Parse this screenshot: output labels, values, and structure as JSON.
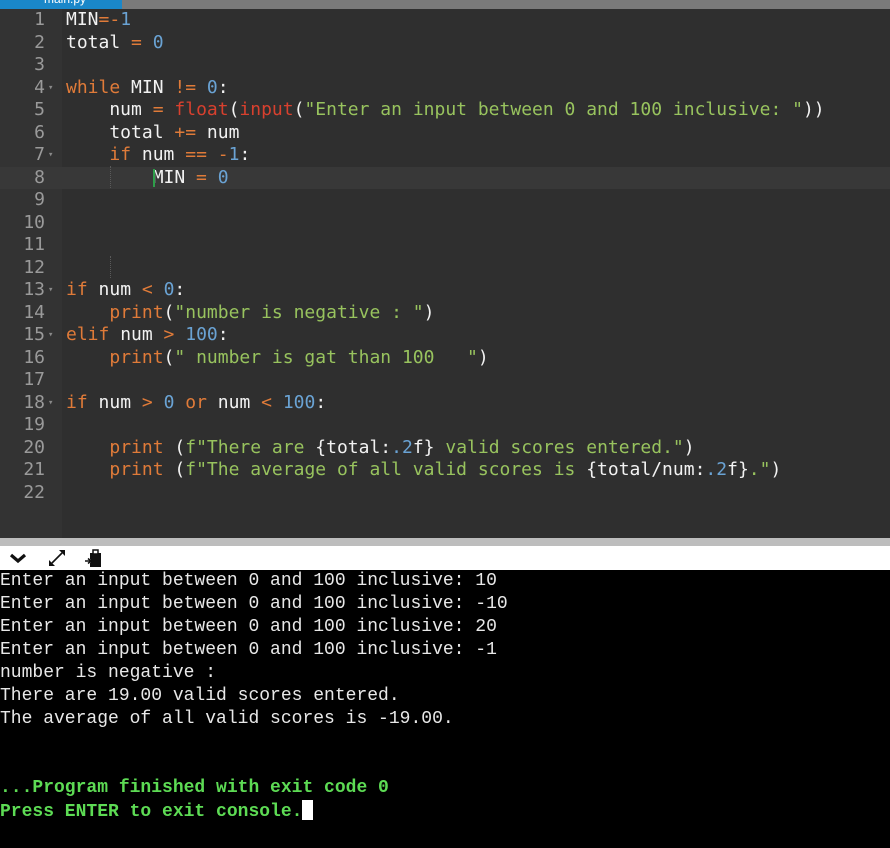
{
  "tab": {
    "label": "main.py"
  },
  "editor": {
    "active_line": 8,
    "lines": [
      {
        "num": "1",
        "fold": false,
        "tokens": [
          {
            "c": "t",
            "v": "MIN"
          },
          {
            "c": "o",
            "v": "=-"
          },
          {
            "c": "n",
            "v": "1"
          }
        ]
      },
      {
        "num": "2",
        "fold": false,
        "tokens": [
          {
            "c": "t",
            "v": "total "
          },
          {
            "c": "o",
            "v": "="
          },
          {
            "c": "t",
            "v": " "
          },
          {
            "c": "n",
            "v": "0"
          }
        ]
      },
      {
        "num": "3",
        "fold": false,
        "tokens": []
      },
      {
        "num": "4",
        "fold": true,
        "tokens": [
          {
            "c": "k",
            "v": "while"
          },
          {
            "c": "t",
            "v": " MIN "
          },
          {
            "c": "o",
            "v": "!="
          },
          {
            "c": "t",
            "v": " "
          },
          {
            "c": "n",
            "v": "0"
          },
          {
            "c": "t",
            "v": ":"
          }
        ]
      },
      {
        "num": "5",
        "fold": false,
        "tokens": [
          {
            "c": "t",
            "v": "    num "
          },
          {
            "c": "o",
            "v": "="
          },
          {
            "c": "t",
            "v": " "
          },
          {
            "c": "f",
            "v": "float"
          },
          {
            "c": "t",
            "v": "("
          },
          {
            "c": "f",
            "v": "input"
          },
          {
            "c": "t",
            "v": "("
          },
          {
            "c": "s",
            "v": "\"Enter an input between 0 and 100 inclusive: \""
          },
          {
            "c": "t",
            "v": "))"
          }
        ]
      },
      {
        "num": "6",
        "fold": false,
        "tokens": [
          {
            "c": "t",
            "v": "    total "
          },
          {
            "c": "o",
            "v": "+="
          },
          {
            "c": "t",
            "v": " num"
          }
        ]
      },
      {
        "num": "7",
        "fold": true,
        "tokens": [
          {
            "c": "t",
            "v": "    "
          },
          {
            "c": "k",
            "v": "if"
          },
          {
            "c": "t",
            "v": " num "
          },
          {
            "c": "o",
            "v": "=="
          },
          {
            "c": "t",
            "v": " "
          },
          {
            "c": "o",
            "v": "-"
          },
          {
            "c": "n",
            "v": "1"
          },
          {
            "c": "t",
            "v": ":"
          }
        ]
      },
      {
        "num": "8",
        "fold": false,
        "tokens": [
          {
            "c": "t",
            "v": "        MIN "
          },
          {
            "c": "o",
            "v": "="
          },
          {
            "c": "t",
            "v": " "
          },
          {
            "c": "n",
            "v": "0"
          }
        ]
      },
      {
        "num": "9",
        "fold": false,
        "tokens": []
      },
      {
        "num": "10",
        "fold": false,
        "tokens": []
      },
      {
        "num": "11",
        "fold": false,
        "tokens": []
      },
      {
        "num": "12",
        "fold": false,
        "tokens": []
      },
      {
        "num": "13",
        "fold": true,
        "tokens": [
          {
            "c": "k",
            "v": "if"
          },
          {
            "c": "t",
            "v": " num "
          },
          {
            "c": "o",
            "v": "<"
          },
          {
            "c": "t",
            "v": " "
          },
          {
            "c": "n",
            "v": "0"
          },
          {
            "c": "t",
            "v": ":"
          }
        ]
      },
      {
        "num": "14",
        "fold": false,
        "tokens": [
          {
            "c": "t",
            "v": "    "
          },
          {
            "c": "k",
            "v": "print"
          },
          {
            "c": "t",
            "v": "("
          },
          {
            "c": "s",
            "v": "\"number is negative : \""
          },
          {
            "c": "t",
            "v": ")"
          }
        ]
      },
      {
        "num": "15",
        "fold": true,
        "tokens": [
          {
            "c": "k",
            "v": "elif"
          },
          {
            "c": "t",
            "v": " num "
          },
          {
            "c": "o",
            "v": ">"
          },
          {
            "c": "t",
            "v": " "
          },
          {
            "c": "n",
            "v": "100"
          },
          {
            "c": "t",
            "v": ":"
          }
        ]
      },
      {
        "num": "16",
        "fold": false,
        "tokens": [
          {
            "c": "t",
            "v": "    "
          },
          {
            "c": "k",
            "v": "print"
          },
          {
            "c": "t",
            "v": "("
          },
          {
            "c": "s",
            "v": "\" number is gat than 100   \""
          },
          {
            "c": "t",
            "v": ")"
          }
        ]
      },
      {
        "num": "17",
        "fold": false,
        "tokens": []
      },
      {
        "num": "18",
        "fold": true,
        "tokens": [
          {
            "c": "k",
            "v": "if"
          },
          {
            "c": "t",
            "v": " num "
          },
          {
            "c": "o",
            "v": ">"
          },
          {
            "c": "t",
            "v": " "
          },
          {
            "c": "n",
            "v": "0"
          },
          {
            "c": "t",
            "v": " "
          },
          {
            "c": "k",
            "v": "or"
          },
          {
            "c": "t",
            "v": " num "
          },
          {
            "c": "o",
            "v": "<"
          },
          {
            "c": "t",
            "v": " "
          },
          {
            "c": "n",
            "v": "100"
          },
          {
            "c": "t",
            "v": ":"
          }
        ]
      },
      {
        "num": "19",
        "fold": false,
        "tokens": []
      },
      {
        "num": "20",
        "fold": false,
        "tokens": [
          {
            "c": "t",
            "v": "    "
          },
          {
            "c": "k",
            "v": "print"
          },
          {
            "c": "t",
            "v": " ("
          },
          {
            "c": "s",
            "v": "f\"There are "
          },
          {
            "c": "t",
            "v": "{total:"
          },
          {
            "c": "n",
            "v": ".2"
          },
          {
            "c": "t",
            "v": "f}"
          },
          {
            "c": "s",
            "v": " valid scores entered.\""
          },
          {
            "c": "t",
            "v": ")"
          }
        ]
      },
      {
        "num": "21",
        "fold": false,
        "tokens": [
          {
            "c": "t",
            "v": "    "
          },
          {
            "c": "k",
            "v": "print"
          },
          {
            "c": "t",
            "v": " ("
          },
          {
            "c": "s",
            "v": "f\"The average of all valid scores is "
          },
          {
            "c": "t",
            "v": "{total/num:"
          },
          {
            "c": "n",
            "v": ".2"
          },
          {
            "c": "t",
            "v": "f}"
          },
          {
            "c": "s",
            "v": ".\""
          },
          {
            "c": "t",
            "v": ")"
          }
        ]
      },
      {
        "num": "22",
        "fold": false,
        "tokens": []
      }
    ]
  },
  "toolbar": {
    "collapse_icon": "chevron-down-icon",
    "expand_icon": "expand-arrows-icon",
    "copy_icon": "clipboard-paste-icon"
  },
  "console": {
    "output": [
      "Enter an input between 0 and 100 inclusive: 10",
      "Enter an input between 0 and 100 inclusive: -10",
      "Enter an input between 0 and 100 inclusive: 20",
      "Enter an input between 0 and 100 inclusive: -1",
      "number is negative :",
      "There are 19.00 valid scores entered.",
      "The average of all valid scores is -19.00.",
      "",
      ""
    ],
    "status": [
      "...Program finished with exit code 0",
      "Press ENTER to exit console."
    ]
  },
  "colors": {
    "keyword": "#e07b39",
    "number": "#6aa3d4",
    "string": "#98c35e",
    "builtin": "#d8402e",
    "console_status": "#5ddb54",
    "tab_active": "#1a87c9"
  }
}
